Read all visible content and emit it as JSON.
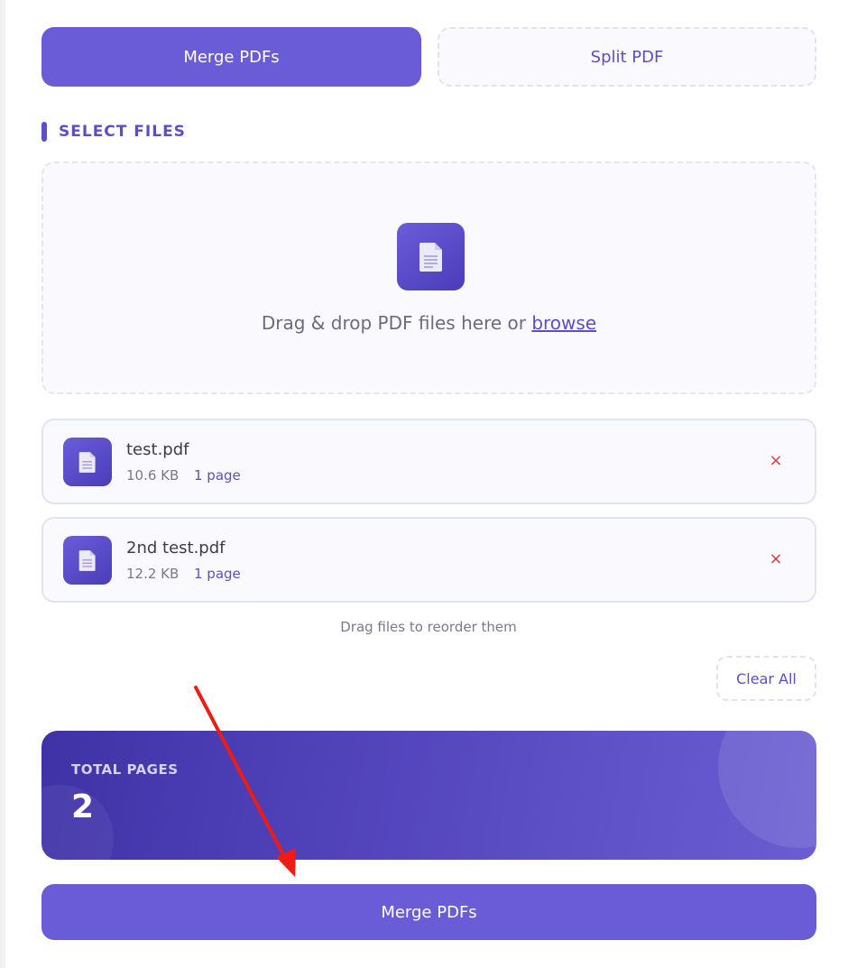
{
  "tabs": {
    "merge_label": "Merge PDFs",
    "split_label": "Split PDF",
    "active": "Merge PDFs"
  },
  "select_section": {
    "title": "SELECT FILES"
  },
  "dropzone": {
    "text": "Drag & drop PDF files here or ",
    "browse_label": "browse",
    "icon": "file-icon"
  },
  "files": [
    {
      "name": "test.pdf",
      "size": "10.6 KB",
      "pages": "1 page",
      "remove_glyph": "×"
    },
    {
      "name": "2nd test.pdf",
      "size": "12.2 KB",
      "pages": "1 page",
      "remove_glyph": "×"
    }
  ],
  "reorder_hint": "Drag files to reorder them",
  "clear_all_label": "Clear All",
  "summary": {
    "label": "TOTAL PAGES",
    "value": "2"
  },
  "action_button": {
    "label": "Merge PDFs"
  },
  "colors": {
    "accent": "#6a5bd6",
    "danger": "#e53935",
    "annotation_arrow": "#f01b14"
  }
}
